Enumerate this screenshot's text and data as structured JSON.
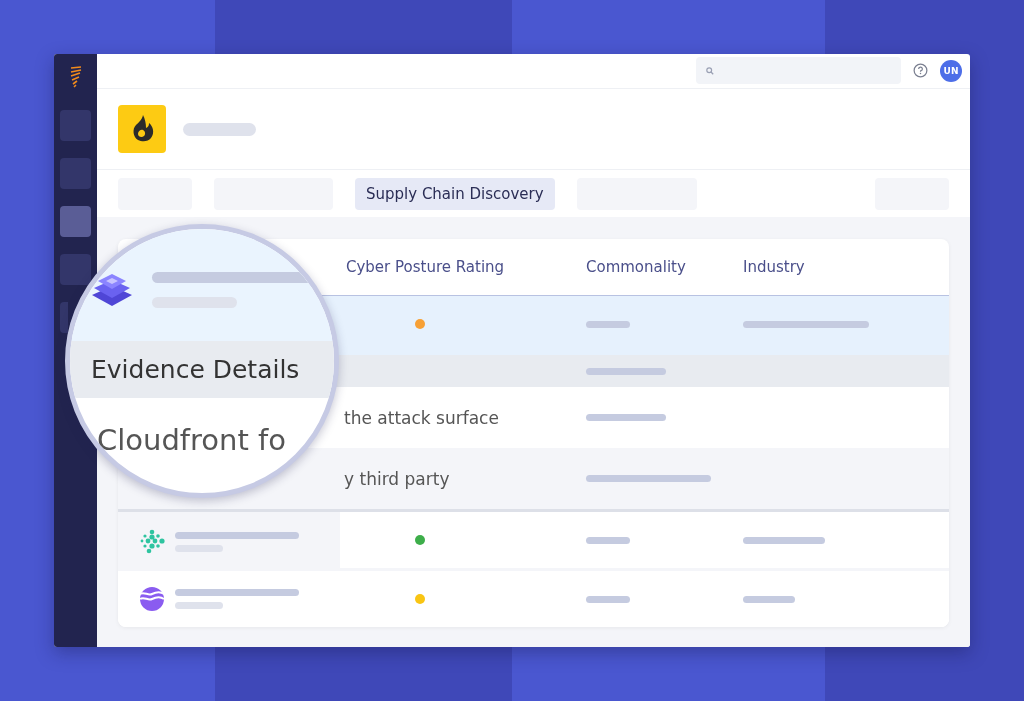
{
  "topbar": {
    "avatar": "UN"
  },
  "sidebar": {
    "items": [
      {
        "selected": false
      },
      {
        "selected": false
      },
      {
        "selected": true
      },
      {
        "selected": false
      },
      {
        "selected": false
      }
    ]
  },
  "tabs": [
    {
      "selected": false
    },
    {
      "selected": false
    },
    {
      "label": "Supply Chain Discovery",
      "selected": true
    },
    {
      "selected": false
    },
    {
      "selected": false
    }
  ],
  "table": {
    "columns": [
      "Cyber Posture Rating",
      "Commonality",
      "Industry"
    ],
    "rows": [
      {
        "kind": "vendor",
        "color": "#f7a035",
        "selected": true
      },
      {
        "kind": "section",
        "selected": false
      },
      {
        "kind": "evidence",
        "text": "the attack surface",
        "selected": false
      },
      {
        "kind": "evidence",
        "text": "y third party",
        "selected": false
      },
      {
        "kind": "vendor",
        "color": "#3dae4a",
        "selected": false
      },
      {
        "kind": "vendor",
        "color": "#f9c513",
        "selected": false
      }
    ]
  },
  "magnifier": {
    "heading": "Evidence Details",
    "text": "Cloudfront fo"
  }
}
